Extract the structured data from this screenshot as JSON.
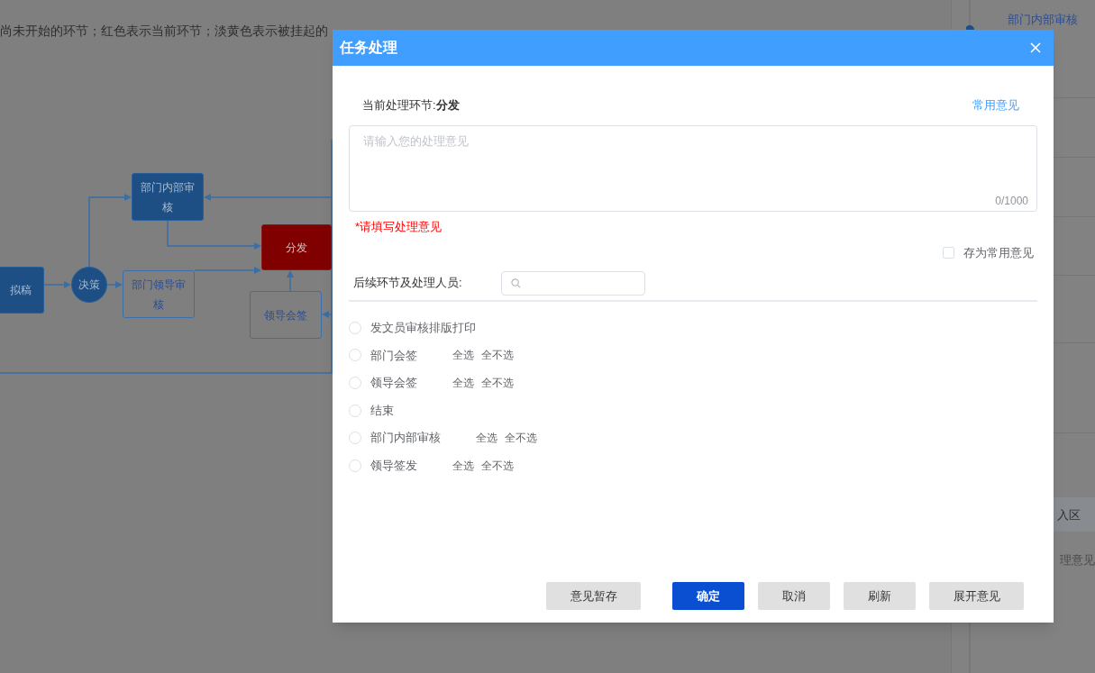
{
  "background": {
    "legend_text": "尚未开始的环节；红色表示当前环节；淡黄色表示被挂起的",
    "flowchart": {
      "nodes": [
        {
          "label": "拟稿",
          "kind": "done"
        },
        {
          "label": "决策",
          "kind": "decision"
        },
        {
          "label": "部门内部审核",
          "kind": "done"
        },
        {
          "label": "部门领导审核",
          "kind": "pending"
        },
        {
          "label": "分发",
          "kind": "current"
        },
        {
          "label": "领导会签",
          "kind": "pending"
        }
      ]
    },
    "side_panel": {
      "items": [
        "部门内部审核",
        "入区",
        "理意见"
      ]
    }
  },
  "dialog": {
    "title": "任务处理",
    "current_step_label": "当前处理环节:",
    "current_step": "分发",
    "common_opinions_link": "常用意见",
    "opinion": {
      "placeholder": "请输入您的处理意见",
      "counter": "0/1000"
    },
    "required_hint": "*请填写处理意见",
    "save_as_common": {
      "label": "存为常用意见",
      "checked": false
    },
    "next_steps_label": "后续环节及处理人员:",
    "steps": [
      {
        "label": "发文员审核排版打印",
        "selected": false
      },
      {
        "label": "部门会签",
        "selected": false,
        "select_all": "全选",
        "select_none": "全不选"
      },
      {
        "label": "领导会签",
        "selected": false,
        "select_all": "全选",
        "select_none": "全不选"
      },
      {
        "label": "结束",
        "selected": false
      },
      {
        "label": "部门内部审核",
        "selected": false,
        "select_all": "全选",
        "select_none": "全不选"
      },
      {
        "label": "领导签发",
        "selected": false,
        "select_all": "全选",
        "select_none": "全不选"
      }
    ],
    "buttons": [
      {
        "label": "意见暂存",
        "kind": "secondary"
      },
      {
        "label": "确定",
        "kind": "primary"
      },
      {
        "label": "取消",
        "kind": "secondary"
      },
      {
        "label": "刷新",
        "kind": "secondary"
      },
      {
        "label": "展开意见",
        "kind": "secondary"
      }
    ]
  }
}
